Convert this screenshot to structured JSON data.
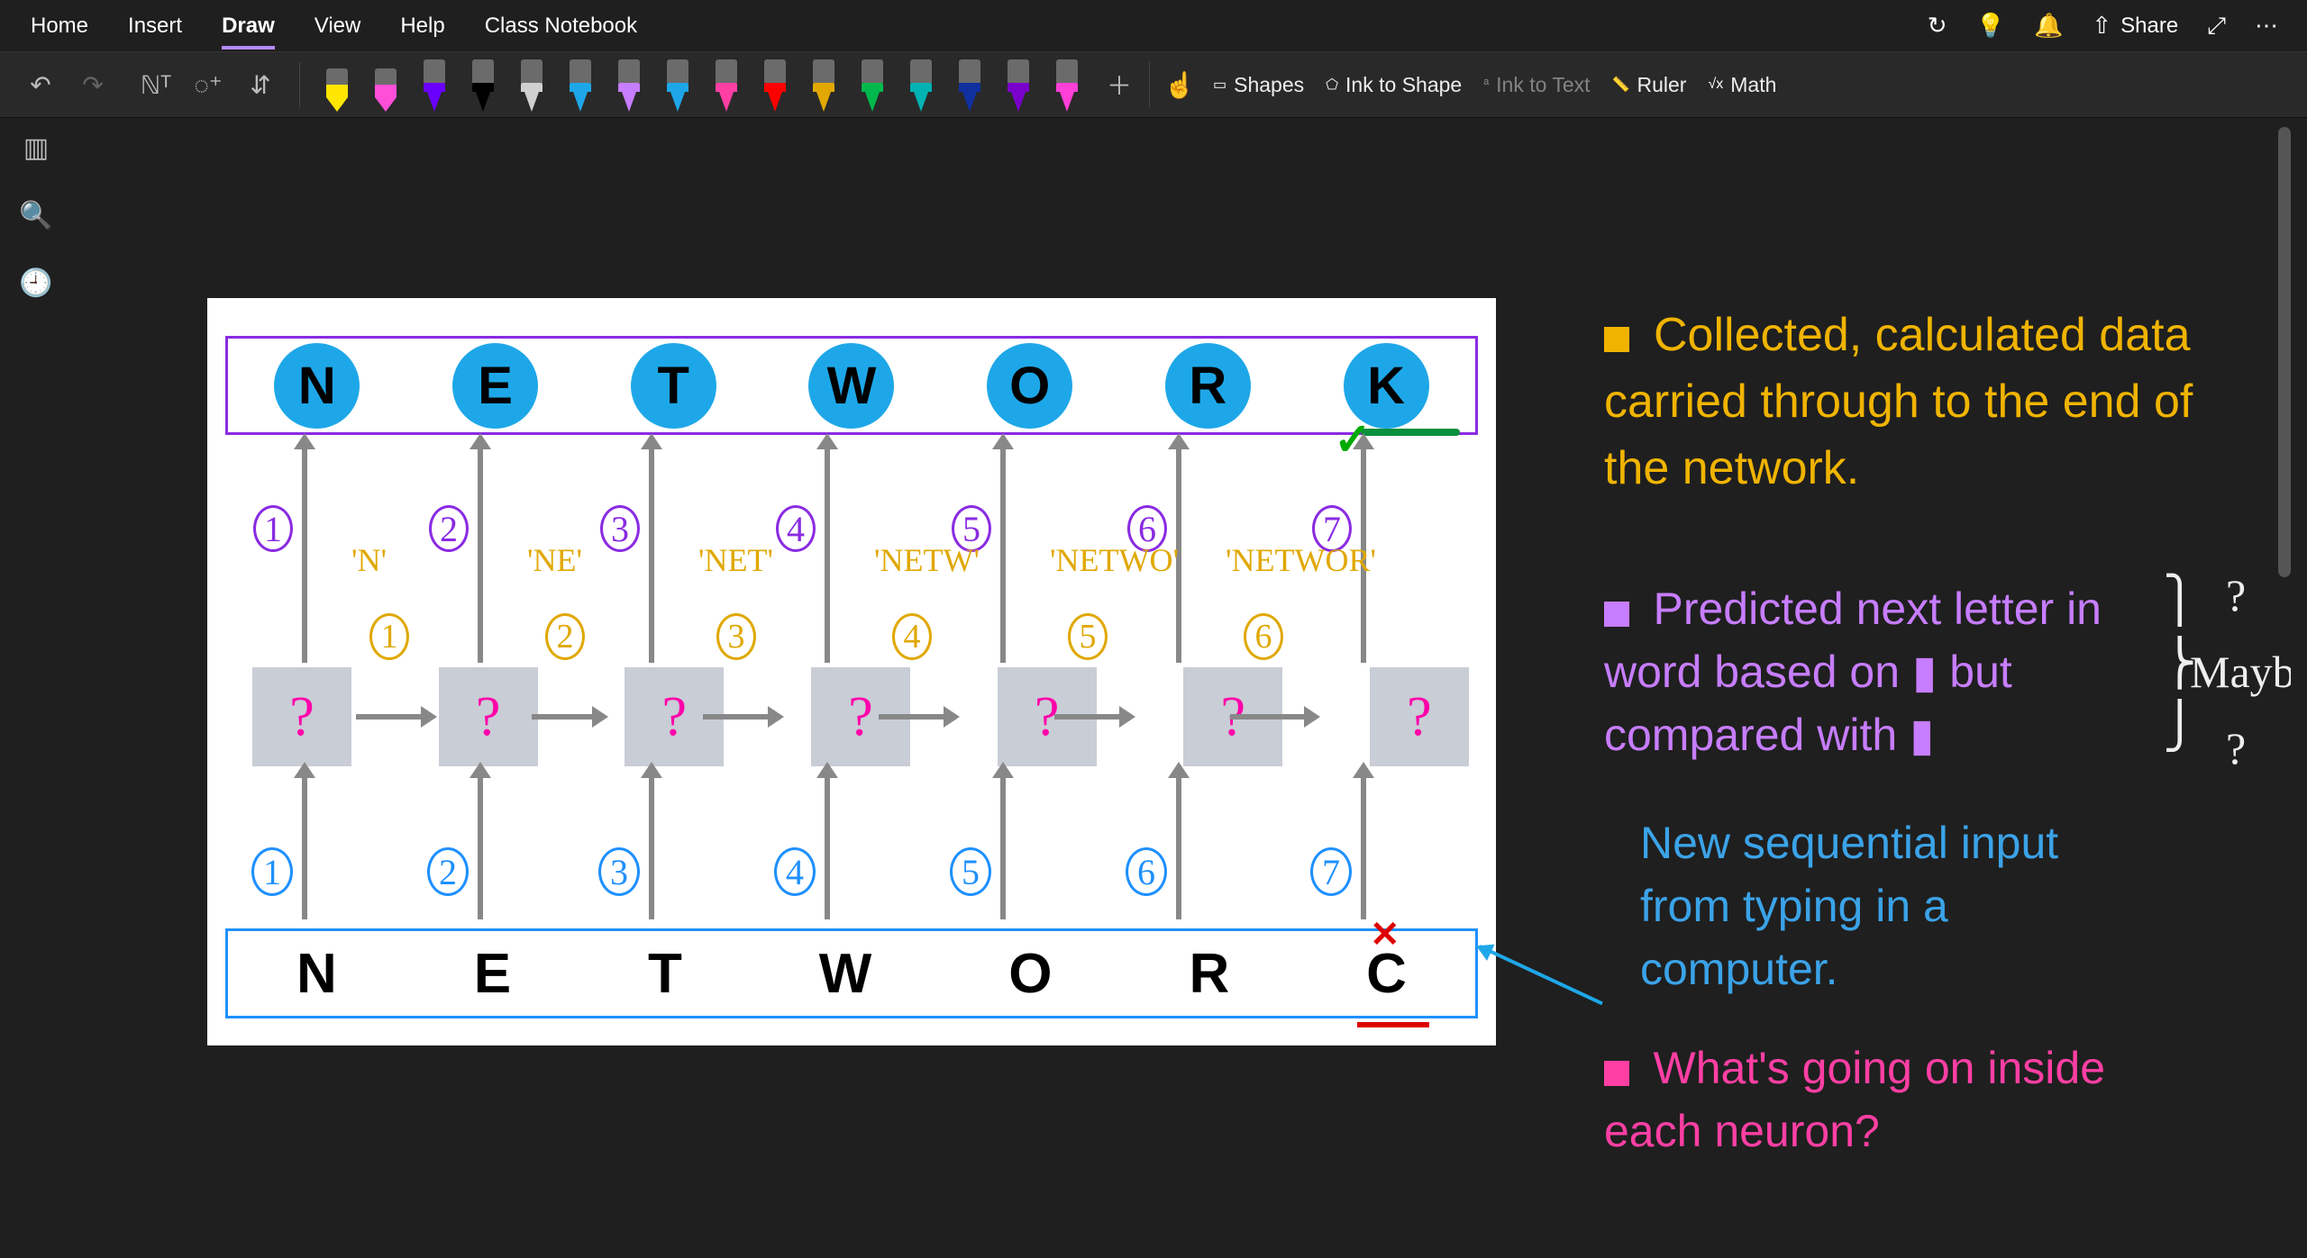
{
  "app": {
    "share_label": "Share"
  },
  "menus": [
    "Home",
    "Insert",
    "Draw",
    "View",
    "Help",
    "Class Notebook"
  ],
  "active_menu": "Draw",
  "tools": {
    "shapes": "Shapes",
    "ink_to_shape": "Ink to Shape",
    "ink_to_text": "Ink to Text",
    "ruler": "Ruler",
    "math": "Math"
  },
  "pens": [
    {
      "type": "highlighter",
      "color": "#ffe600"
    },
    {
      "type": "highlighter",
      "color": "#ff4fd8"
    },
    {
      "type": "pen",
      "color": "#6a00ff"
    },
    {
      "type": "pen",
      "color": "#000000"
    },
    {
      "type": "pen",
      "color": "#d0d0d0"
    },
    {
      "type": "pen",
      "color": "#1ea7e8"
    },
    {
      "type": "pen",
      "color": "#c77dff"
    },
    {
      "type": "pen",
      "color": "#1ea7e8"
    },
    {
      "type": "pen",
      "color": "#ff3fa4"
    },
    {
      "type": "pen",
      "color": "#ff0000"
    },
    {
      "type": "pen",
      "color": "#e0a800"
    },
    {
      "type": "pen",
      "color": "#00b84c"
    },
    {
      "type": "pen",
      "color": "#00b2b2"
    },
    {
      "type": "pen",
      "color": "#1030a0"
    },
    {
      "type": "pen",
      "color": "#7a00cc"
    },
    {
      "type": "pen",
      "color": "#ff3fd8"
    }
  ],
  "diagram": {
    "top_letters": [
      "N",
      "E",
      "T",
      "W",
      "O",
      "R",
      "K"
    ],
    "bottom_letters": [
      "N",
      "E",
      "T",
      "W",
      "O",
      "R",
      "C"
    ],
    "hidden_marks": [
      "?",
      "?",
      "?",
      "?",
      "?",
      "?",
      "?"
    ],
    "step_labels_top": [
      "1",
      "2",
      "3",
      "4",
      "5",
      "6",
      "7"
    ],
    "step_labels_mid": [
      "1",
      "2",
      "3",
      "4",
      "5",
      "6"
    ],
    "step_labels_bottom": [
      "1",
      "2",
      "3",
      "4",
      "5",
      "6",
      "7"
    ],
    "carried_words": [
      "'N'",
      "'NE'",
      "'NET'",
      "'NETW'",
      "'NETWO'",
      "'NETWOR'"
    ]
  },
  "notes": {
    "n1": "Collected, calculated data carried through to the end of the network.",
    "n2": "Predicted next letter in word based on ▮ but compared with ▮",
    "n2_q1": "?",
    "n2_maybe": "Maybe?",
    "n2_q2": "?",
    "n3": "New sequential input from typing in a computer.",
    "n4": "What's going on inside each neuron?"
  }
}
